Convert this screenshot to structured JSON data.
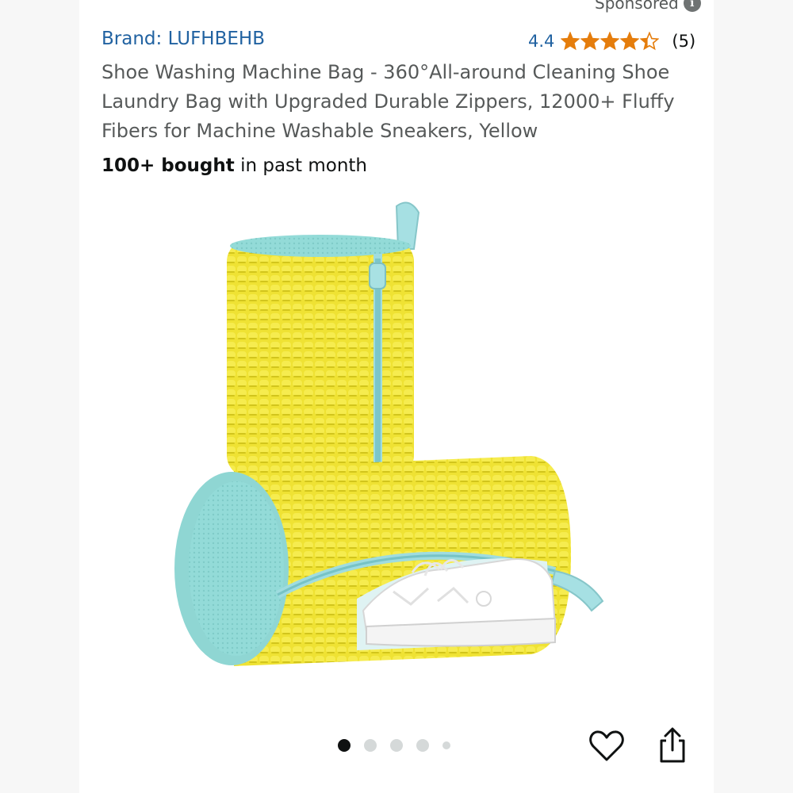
{
  "sponsored": {
    "label": "Sponsored",
    "info_icon": "i"
  },
  "product": {
    "brand": "Brand: LUFHBEHB",
    "rating_value": "4.4",
    "rating_stars": 4.4,
    "review_count": "(5)",
    "title": "Shoe Washing Machine Bag - 360°All-around Cleaning Shoe Laundry Bag with Upgraded Durable Zippers, 12000+ Fluffy Fibers for Machine Washable Sneakers, Yellow",
    "bought_bold": "100+ bought",
    "bought_rest": " in past month"
  },
  "carousel": {
    "image_count": 5,
    "active_index": 0
  },
  "icons": {
    "favorite": "heart-icon",
    "share": "share-icon"
  },
  "colors": {
    "link_blue": "#2162a1",
    "star_orange": "#e57d0c",
    "bag_yellow": "#ecdf28",
    "mesh_teal": "#8fd9d6"
  }
}
